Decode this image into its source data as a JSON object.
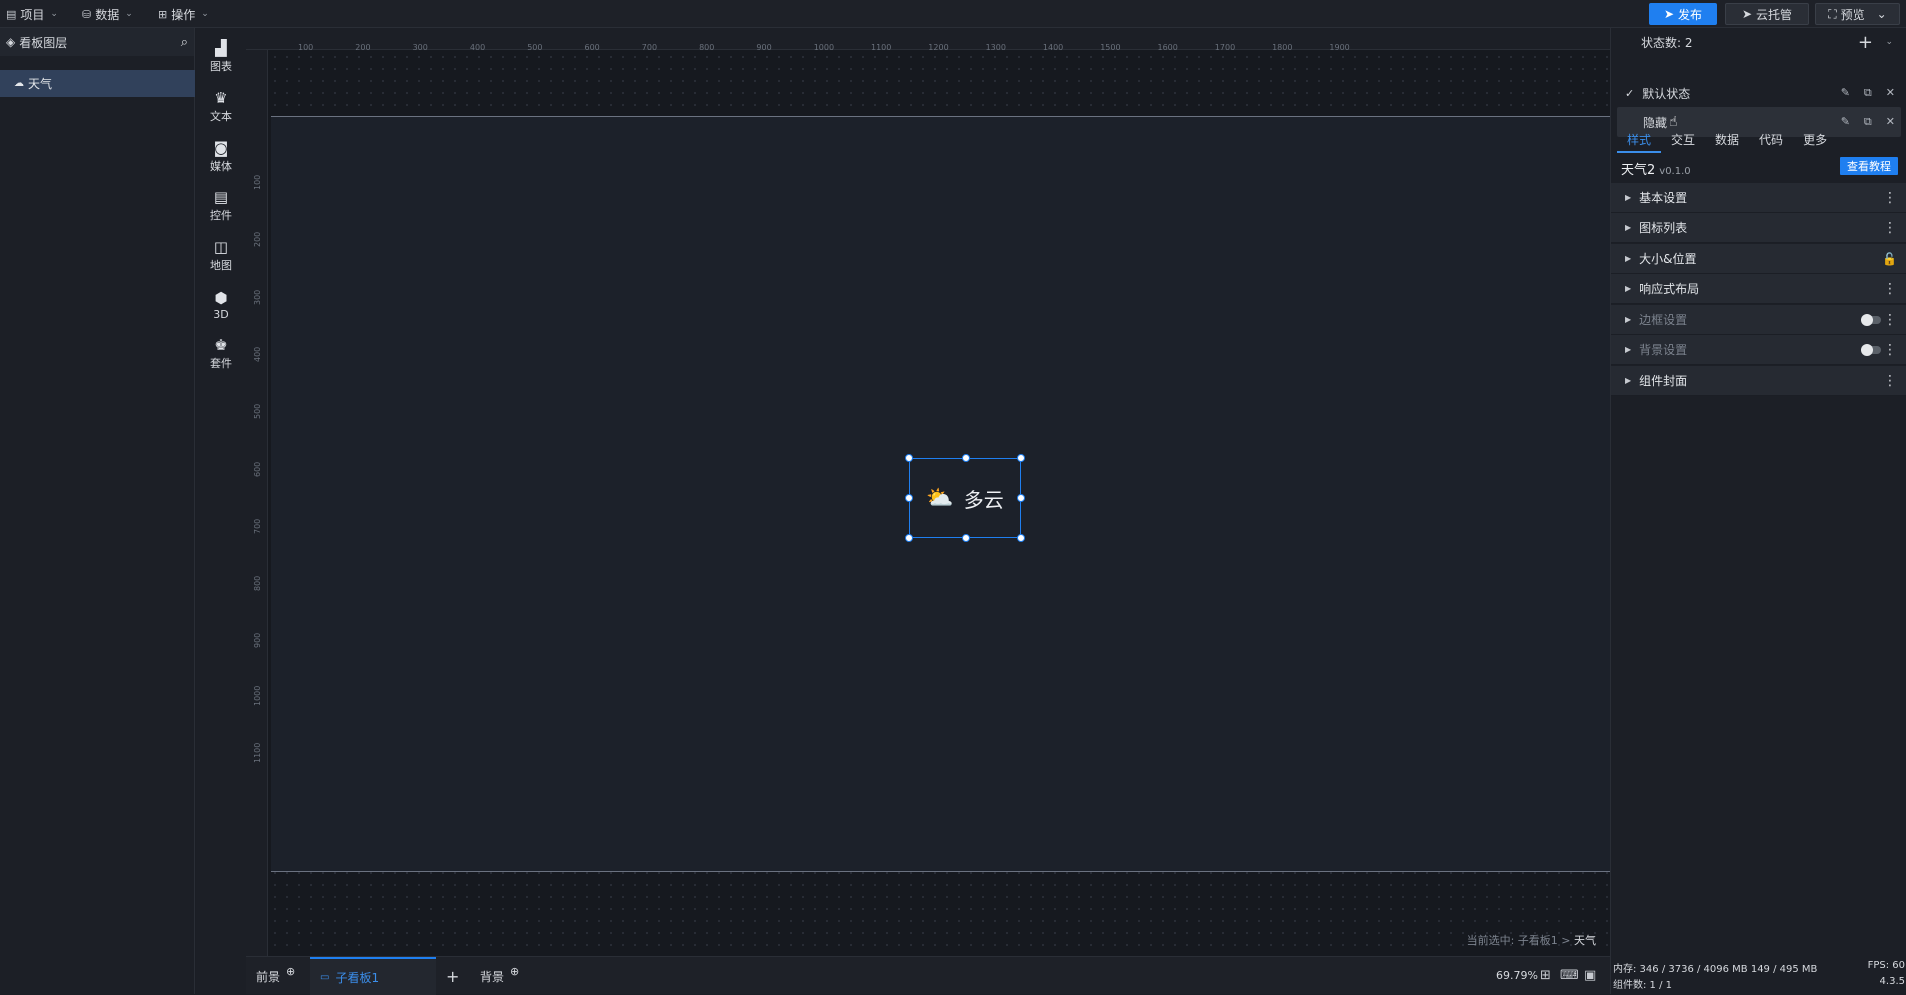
{
  "topbar": {
    "menu": [
      {
        "icon": "file-icon",
        "label": "项目"
      },
      {
        "icon": "database-icon",
        "label": "数据"
      },
      {
        "icon": "grid-icon",
        "label": "操作"
      }
    ],
    "publish": "发布",
    "cloud": "云托管",
    "preview": "预览"
  },
  "layers": {
    "title": "看板图层",
    "items": [
      {
        "label": "天气"
      }
    ]
  },
  "components": [
    {
      "icon": "chart-icon",
      "label": "图表"
    },
    {
      "icon": "text-icon",
      "label": "文本"
    },
    {
      "icon": "media-icon",
      "label": "媒体"
    },
    {
      "icon": "control-icon",
      "label": "控件"
    },
    {
      "icon": "map-icon",
      "label": "地图"
    },
    {
      "icon": "cube-icon",
      "label": "3D"
    },
    {
      "icon": "kit-icon",
      "label": "套件"
    }
  ],
  "ruler": {
    "top": [
      "100",
      "200",
      "300",
      "400",
      "500",
      "600",
      "700",
      "800",
      "900",
      "1000",
      "1100",
      "1200",
      "1300",
      "1400",
      "1500",
      "1600",
      "1700",
      "1800",
      "1900"
    ],
    "left": [
      "100",
      "200",
      "300",
      "400",
      "500",
      "600",
      "700",
      "800",
      "900",
      "1000",
      "1100"
    ]
  },
  "widget": {
    "text": "多云",
    "icon": "partly-cloudy-icon"
  },
  "current_selection": {
    "prefix": "当前选中: 子看板1 > ",
    "name": "天气"
  },
  "bottom": {
    "tabs": [
      "前景",
      "子看板1",
      "背景"
    ],
    "zoom": "69.79%"
  },
  "right": {
    "state_count_label": "状态数: 2",
    "states": [
      {
        "label": "默认状态",
        "checked": true
      },
      {
        "label": "隐藏",
        "checked": false
      }
    ],
    "tabs": [
      "样式",
      "交互",
      "数据",
      "代码",
      "更多"
    ],
    "active_tab": "样式",
    "component_name": "天气2",
    "component_version": "v0.1.0",
    "tutorial": "查看教程",
    "sections": [
      {
        "label": "基本设置",
        "dim": false
      },
      {
        "label": "图标列表",
        "dim": false
      },
      {
        "label": "大小&位置",
        "dim": false
      },
      {
        "label": "响应式布局",
        "dim": false
      },
      {
        "label": "边框设置",
        "dim": true
      },
      {
        "label": "背景设置",
        "dim": true
      },
      {
        "label": "组件封面",
        "dim": false
      }
    ],
    "status": {
      "memory": "内存: 346 / 3736 / 4096 MB  149 / 495 MB",
      "fps": "FPS: 60",
      "count": "组件数: 1 / 1",
      "version": "4.3.5"
    }
  }
}
